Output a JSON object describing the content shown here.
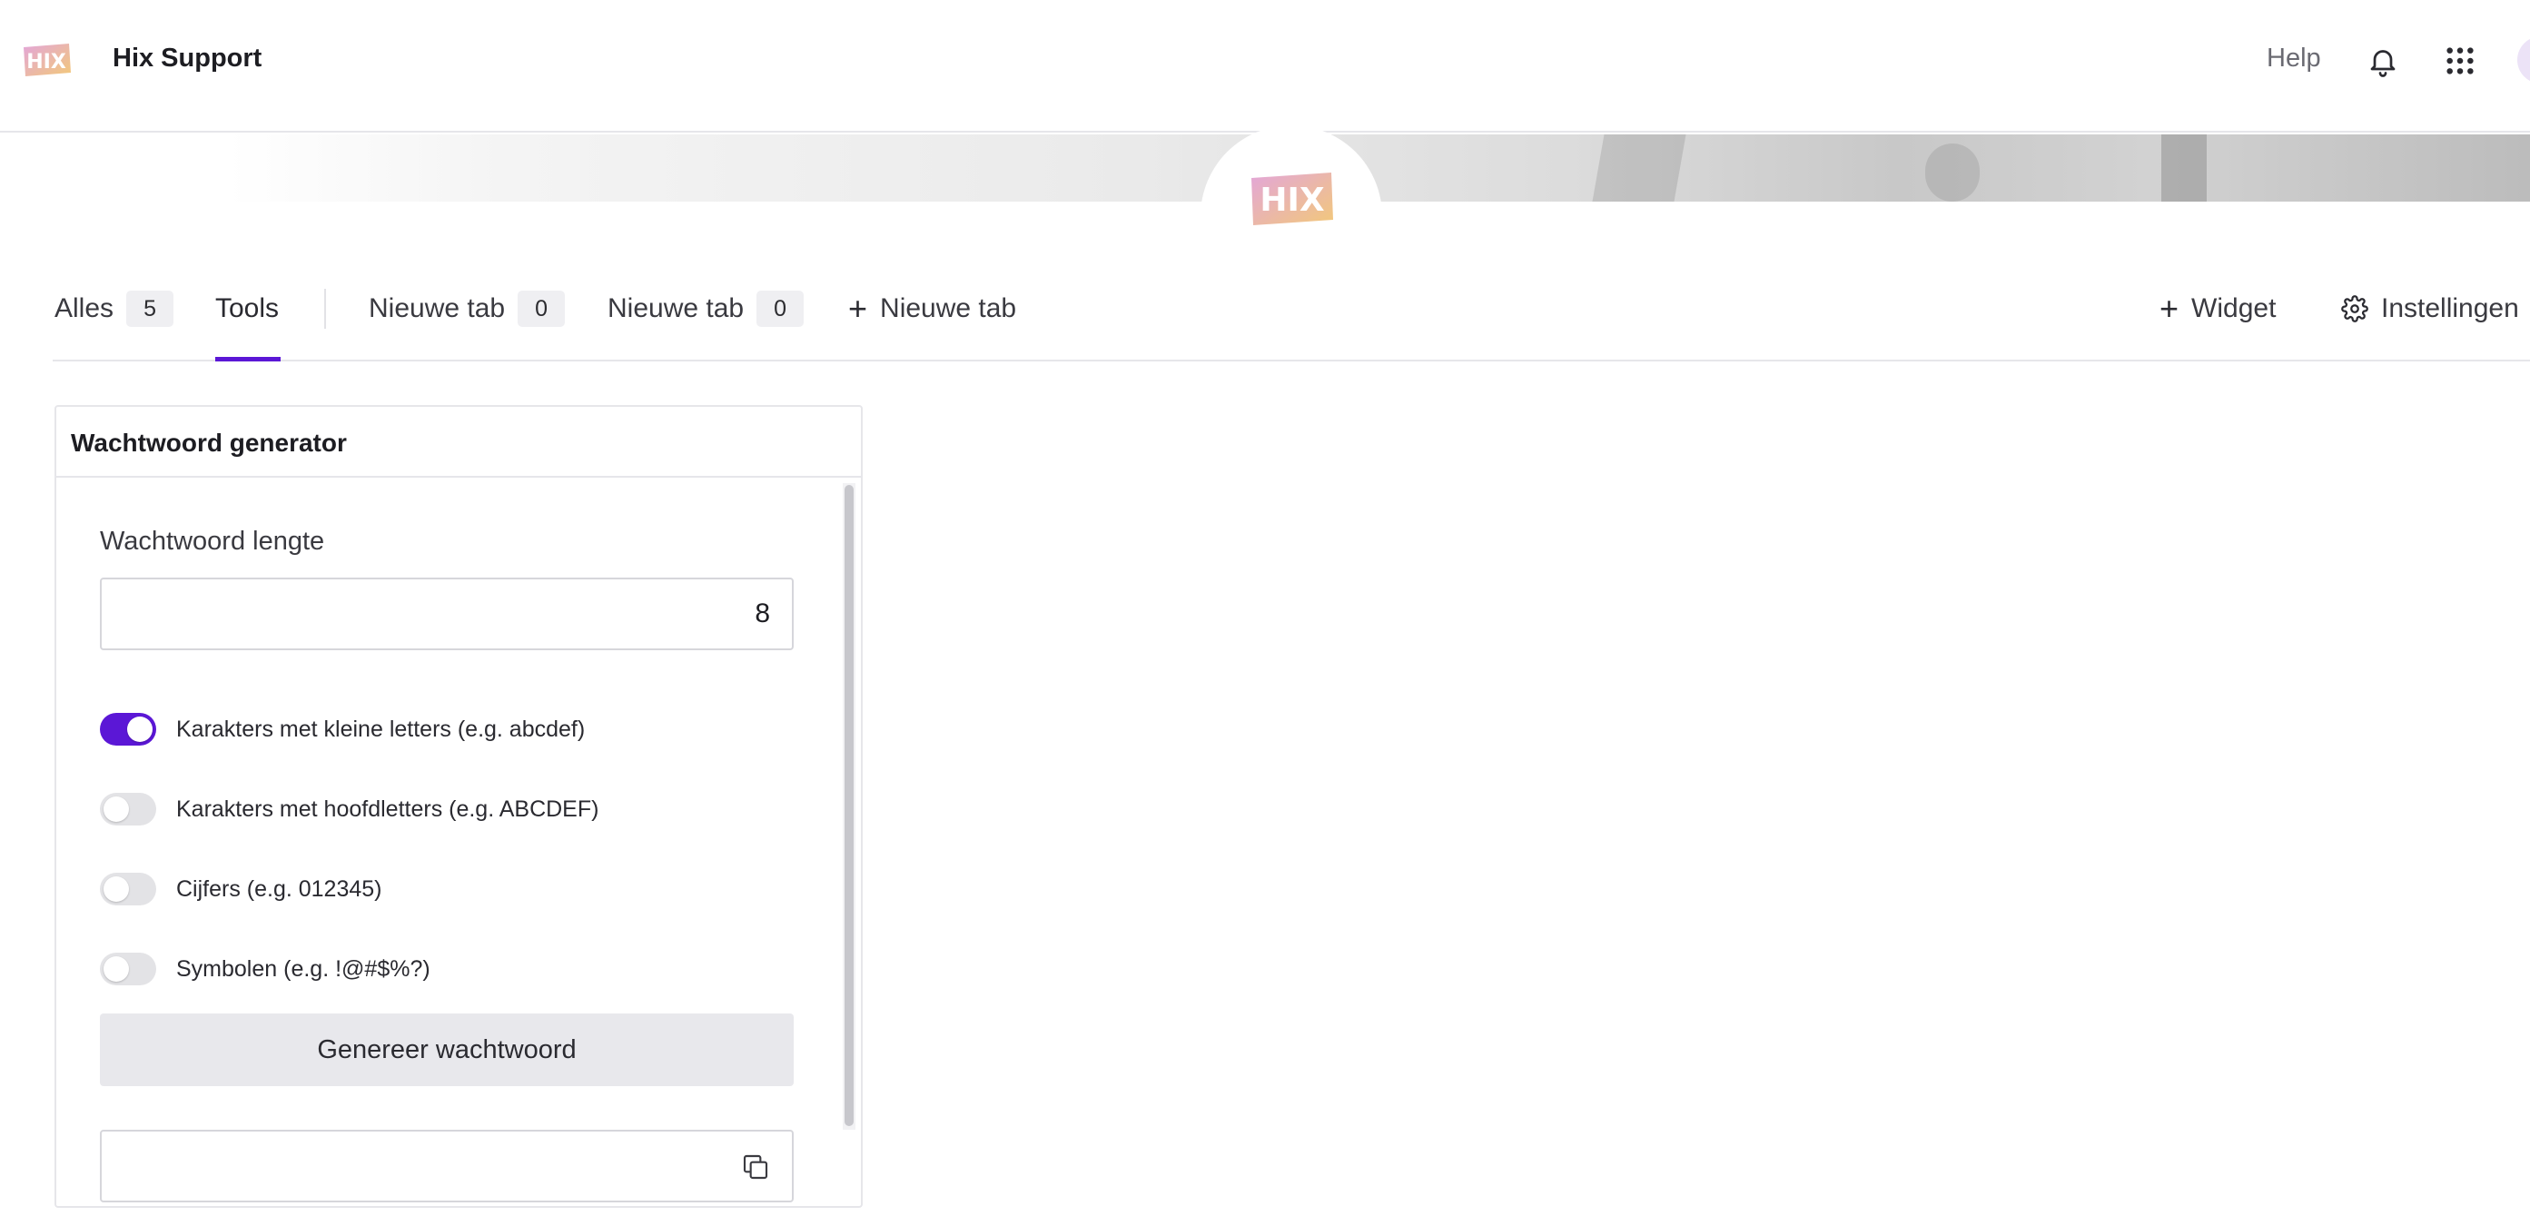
{
  "header": {
    "logo_text": "HIX",
    "app_title": "Hix Support",
    "help_label": "Help",
    "icons": [
      "bell-icon",
      "apps-grid-icon"
    ]
  },
  "banner": {
    "logo_text": "HIX"
  },
  "tabs": [
    {
      "label": "Alles",
      "count": "5"
    },
    {
      "label": "Tools",
      "active": true
    },
    {
      "label": "Nieuwe tab",
      "count": "0"
    },
    {
      "label": "Nieuwe tab",
      "count": "0"
    },
    {
      "label": "Nieuwe tab",
      "icon": "plus-icon"
    }
  ],
  "tab_actions": {
    "widget_label": "Widget",
    "settings_label": "Instellingen"
  },
  "widget": {
    "title": "Wachtwoord generator",
    "length_label": "Wachtwoord lengte",
    "length_value": "8",
    "options": [
      {
        "label": "Karakters met kleine letters (e.g. abcdef)",
        "enabled": true
      },
      {
        "label": "Karakters met hoofdletters (e.g. ABCDEF)",
        "enabled": false
      },
      {
        "label": "Cijfers (e.g. 012345)",
        "enabled": false
      },
      {
        "label": "Symbolen (e.g. !@#$%?)",
        "enabled": false
      }
    ],
    "generate_label": "Genereer wachtwoord",
    "output_value": ""
  },
  "colors": {
    "accent": "#5b17d6",
    "border": "#e6e6ea",
    "button_bg": "#e8e8ec"
  }
}
